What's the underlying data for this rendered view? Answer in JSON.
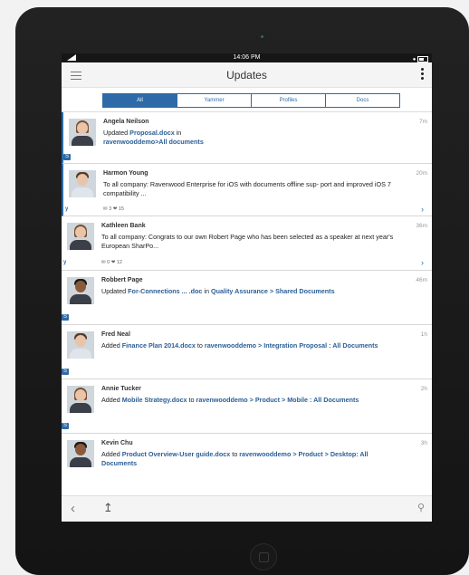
{
  "status": {
    "time": "14:06 PM"
  },
  "nav": {
    "title": "Updates"
  },
  "tabs": [
    {
      "label": "All"
    },
    {
      "label": "Yammer"
    },
    {
      "label": "Profiles"
    },
    {
      "label": "Docs"
    }
  ],
  "feed": [
    {
      "name": "Angela Neilson",
      "time": "7m",
      "text_pre": "Updated ",
      "link1": "Proposal.docx",
      "text_mid": " in",
      "link2": "ravenwooddemo>All documents",
      "source": "S"
    },
    {
      "name": "Harmon Young",
      "time": "20m",
      "text": "To all company: Ravenwood Enterprise for iOS with documents offline sup- port and improved iOS 7 compatibility ...",
      "meta": "✉ 3  ❤ 15",
      "source": "y"
    },
    {
      "name": "Kathleen Bank",
      "time": "36m",
      "text": "To all company: Congrats to our own Robert Page who has been selected as a speaker at next year's European SharPo...",
      "meta": "✉ 0  ❤ 12",
      "source": "y"
    },
    {
      "name": "Robbert Page",
      "time": "46m",
      "text_pre": "Updated ",
      "link1": "For-Connections ... .doc",
      "text_mid": " in ",
      "link2": "Quality Assurance > Shared Documents",
      "source": "S"
    },
    {
      "name": "Fred Neal",
      "time": "1h",
      "text_pre": "Added ",
      "link1": "Finance Plan 2014.docx",
      "text_mid": " to ",
      "link2": "ravenwooddemo > Integration Proposal : All Documents",
      "source": "S"
    },
    {
      "name": "Annie Tucker",
      "time": "2h",
      "text_pre": "Added ",
      "link1": "Mobile Strategy.docx",
      "text_mid": " to ",
      "link2": "ravenwooddemo > Product > Mobile : All Documents",
      "source": "S"
    },
    {
      "name": "Kevin Chu",
      "time": "3h",
      "text_pre": "Added ",
      "link1": "Product Overview-User guide.docx",
      "text_mid": " to ",
      "link2": "ravenwooddemo > Product > Desktop: All Documents",
      "source": "S"
    }
  ],
  "icons": {
    "back": "back-arrow-icon",
    "upload": "upload-icon",
    "search": "search-icon"
  },
  "colors": {
    "accent": "#2e6aa8",
    "link": "#2b5f96"
  }
}
